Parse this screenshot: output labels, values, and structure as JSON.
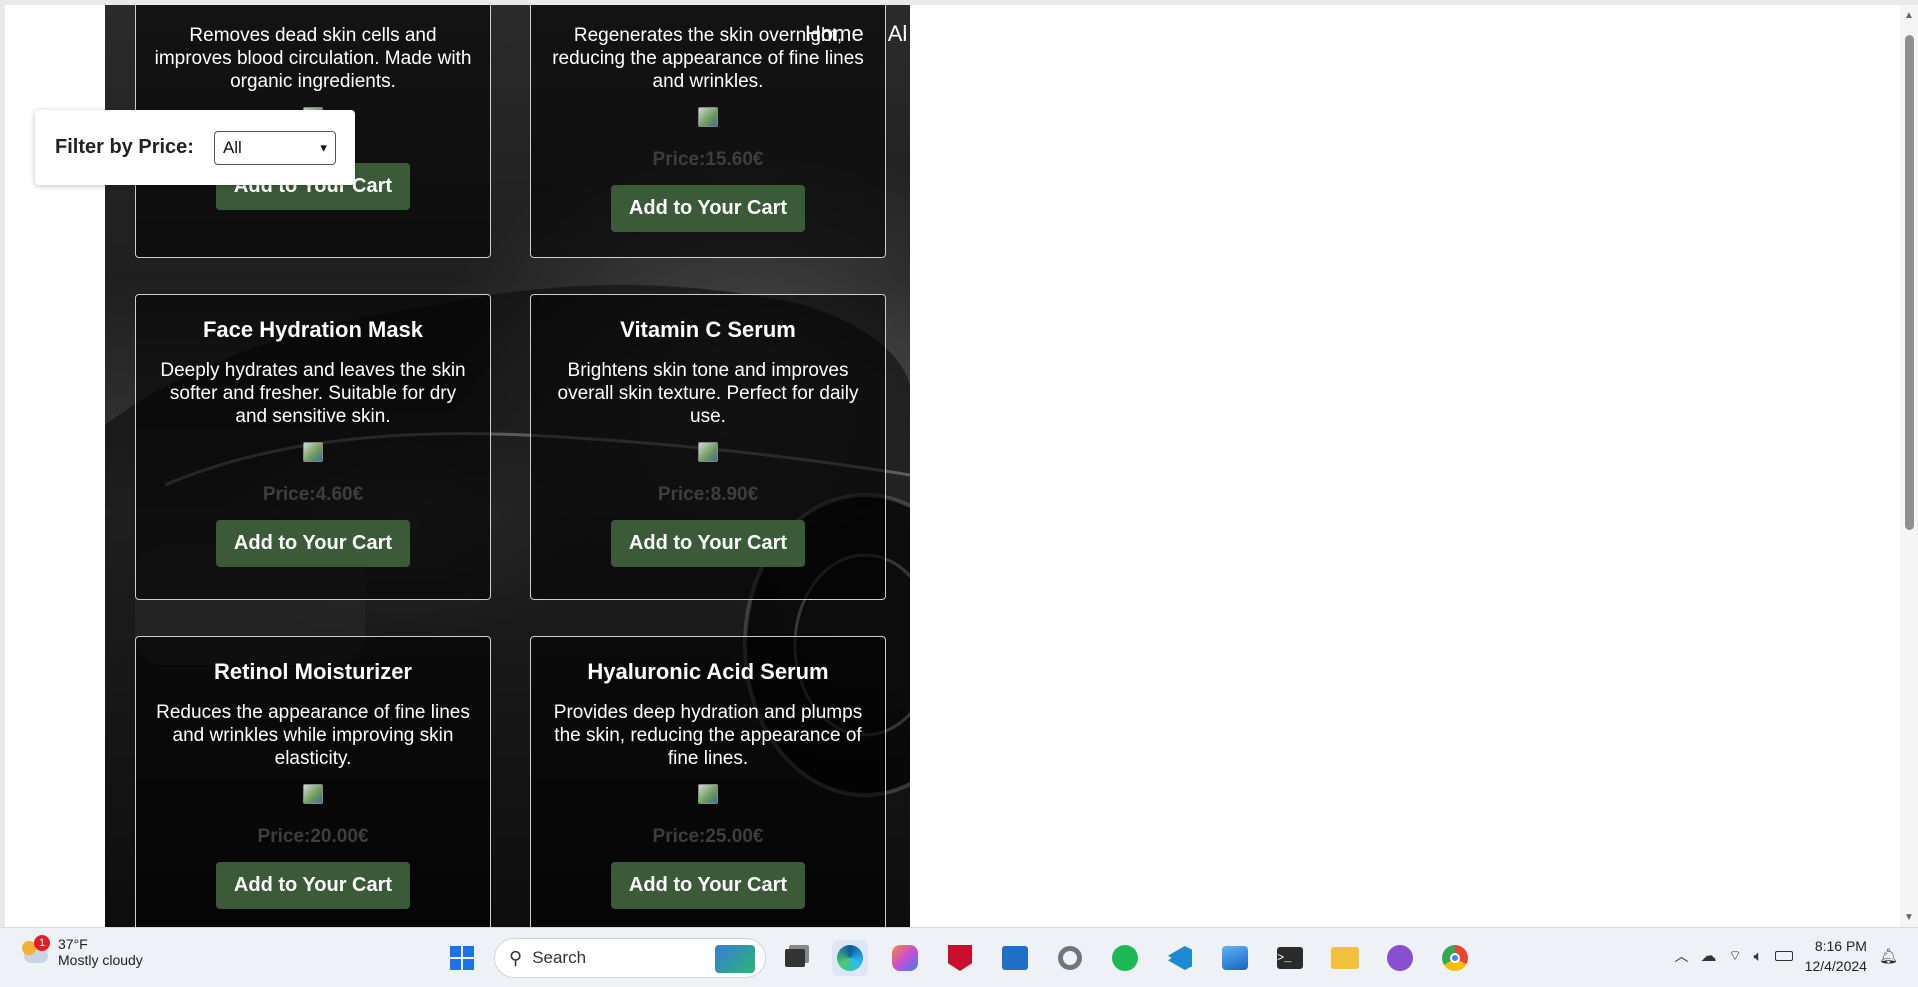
{
  "nav": {
    "items": [
      "Home",
      "Ab"
    ]
  },
  "filter": {
    "label": "Filter by Price:",
    "selected": "All"
  },
  "products": [
    {
      "name": "",
      "description": "Removes dead skin cells and improves blood circulation. Made with organic ingredients.",
      "price": "",
      "button": "Add to Your Cart"
    },
    {
      "name": "",
      "description": "Regenerates the skin overnight, reducing the appearance of fine lines and wrinkles.",
      "price": "Price:15.60€",
      "button": "Add to Your Cart"
    },
    {
      "name": "Face Hydration Mask",
      "description": "Deeply hydrates and leaves the skin softer and fresher. Suitable for dry and sensitive skin.",
      "price": "Price:4.60€",
      "button": "Add to Your Cart"
    },
    {
      "name": "Vitamin C Serum",
      "description": "Brightens skin tone and improves overall skin texture. Perfect for daily use.",
      "price": "Price:8.90€",
      "button": "Add to Your Cart"
    },
    {
      "name": "Retinol Moisturizer",
      "description": "Reduces the appearance of fine lines and wrinkles while improving skin elasticity.",
      "price": "Price:20.00€",
      "button": "Add to Your Cart"
    },
    {
      "name": "Hyaluronic Acid Serum",
      "description": "Provides deep hydration and plumps the skin, reducing the appearance of fine lines.",
      "price": "Price:25.00€",
      "button": "Add to Your Cart"
    }
  ],
  "taskbar": {
    "weather": {
      "temp": "37°F",
      "condition": "Mostly cloudy",
      "badge": "1"
    },
    "search_placeholder": "Search",
    "time": "8:16 PM",
    "date": "12/4/2024",
    "icons": [
      "start-icon",
      "search-icon",
      "task-view-icon",
      "edge-icon",
      "copilot-icon",
      "mcafee-icon",
      "store-icon",
      "settings-icon",
      "spotify-icon",
      "vscode-icon",
      "photos-icon",
      "terminal-icon",
      "file-explorer-icon",
      "github-icon",
      "chrome-icon"
    ]
  }
}
